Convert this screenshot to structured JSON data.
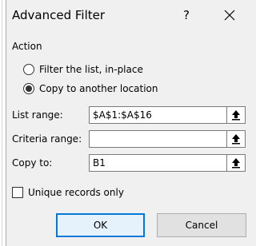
{
  "dialog": {
    "title": "Advanced Filter",
    "help_label": "?"
  },
  "action": {
    "group_label": "Action",
    "options": [
      {
        "label": "Filter the list, in-place",
        "checked": false
      },
      {
        "label": "Copy to another location",
        "checked": true
      }
    ]
  },
  "fields": {
    "list_range": {
      "label": "List range:",
      "value": "$A$1:$A$16"
    },
    "criteria_range": {
      "label": "Criteria range:",
      "value": ""
    },
    "copy_to": {
      "label": "Copy to:",
      "value": "B1"
    }
  },
  "unique": {
    "label": "Unique records only",
    "checked": false
  },
  "buttons": {
    "ok": "OK",
    "cancel": "Cancel"
  },
  "icons": {
    "close": "close-icon",
    "collapse": "collapse-dialog-icon"
  },
  "colors": {
    "accent": "#0078d7",
    "dialog_bg": "#f0f0f0"
  }
}
